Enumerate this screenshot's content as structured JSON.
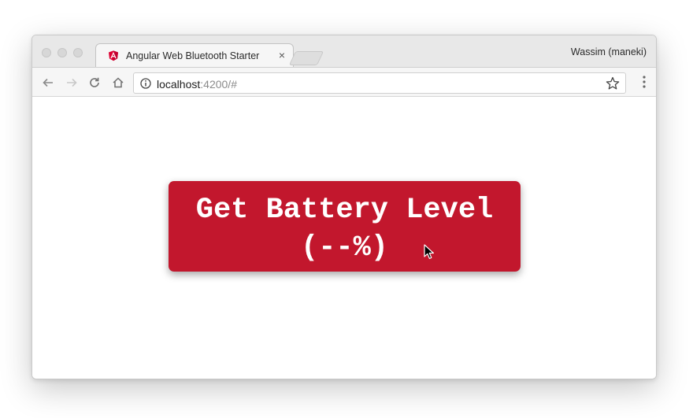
{
  "browser": {
    "tab": {
      "title": "Angular Web Bluetooth Starter",
      "close_glyph": "×",
      "icon": "angular-logo-icon"
    },
    "profile_name": "Wassim (maneki)",
    "address": {
      "host": "localhost",
      "rest": ":4200/#"
    },
    "icons": {
      "back": "back-arrow-icon",
      "forward": "forward-arrow-icon",
      "reload": "reload-icon",
      "home": "home-icon",
      "info": "info-icon",
      "star": "bookmark-star-icon",
      "menu": "kebab-menu-icon"
    }
  },
  "page": {
    "button": {
      "line1": "Get Battery Level",
      "line2": "(--%)"
    }
  },
  "colors": {
    "button_bg": "#c2172d",
    "button_text": "#ffffff",
    "angular_red": "#dd0031"
  }
}
